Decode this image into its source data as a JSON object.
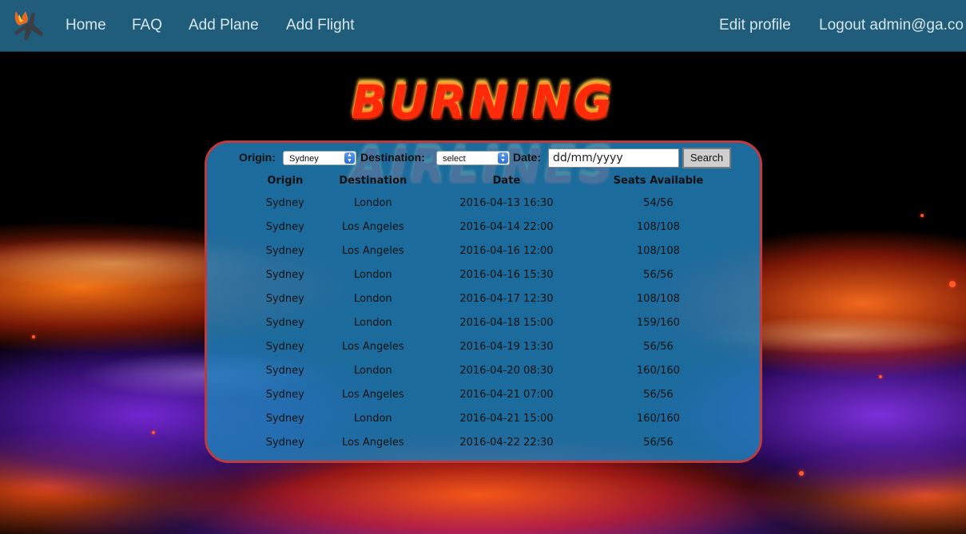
{
  "nav": {
    "home": "Home",
    "faq": "FAQ",
    "add_plane": "Add Plane",
    "add_flight": "Add Flight",
    "edit_profile": "Edit profile",
    "logout": "Logout admin@ga.co"
  },
  "brand": {
    "title": "BURNING AIRLINES"
  },
  "search": {
    "origin_label": "Origin:",
    "origin_value": "Sydney",
    "destination_label": "Destination:",
    "destination_value": "select",
    "date_label": "Date:",
    "date_placeholder": "dd/mm/yyyy",
    "button": "Search"
  },
  "table": {
    "headers": {
      "origin": "Origin",
      "destination": "Destination",
      "date": "Date",
      "seats": "Seats Available"
    },
    "rows": [
      {
        "origin": "Sydney",
        "destination": "London",
        "date": "2016-04-13 16:30",
        "seats": "54/56"
      },
      {
        "origin": "Sydney",
        "destination": "Los Angeles",
        "date": "2016-04-14 22:00",
        "seats": "108/108"
      },
      {
        "origin": "Sydney",
        "destination": "Los Angeles",
        "date": "2016-04-16 12:00",
        "seats": "108/108"
      },
      {
        "origin": "Sydney",
        "destination": "London",
        "date": "2016-04-16 15:30",
        "seats": "56/56"
      },
      {
        "origin": "Sydney",
        "destination": "London",
        "date": "2016-04-17 12:30",
        "seats": "108/108"
      },
      {
        "origin": "Sydney",
        "destination": "London",
        "date": "2016-04-18 15:00",
        "seats": "159/160"
      },
      {
        "origin": "Sydney",
        "destination": "Los Angeles",
        "date": "2016-04-19 13:30",
        "seats": "56/56"
      },
      {
        "origin": "Sydney",
        "destination": "London",
        "date": "2016-04-20 08:30",
        "seats": "160/160"
      },
      {
        "origin": "Sydney",
        "destination": "Los Angeles",
        "date": "2016-04-21 07:00",
        "seats": "56/56"
      },
      {
        "origin": "Sydney",
        "destination": "London",
        "date": "2016-04-21 15:00",
        "seats": "160/160"
      },
      {
        "origin": "Sydney",
        "destination": "Los Angeles",
        "date": "2016-04-22 22:30",
        "seats": "56/56"
      }
    ]
  },
  "colors": {
    "navbar": "#1f5d7b",
    "panel": "#2182be",
    "panel_border": "#c0393b"
  }
}
